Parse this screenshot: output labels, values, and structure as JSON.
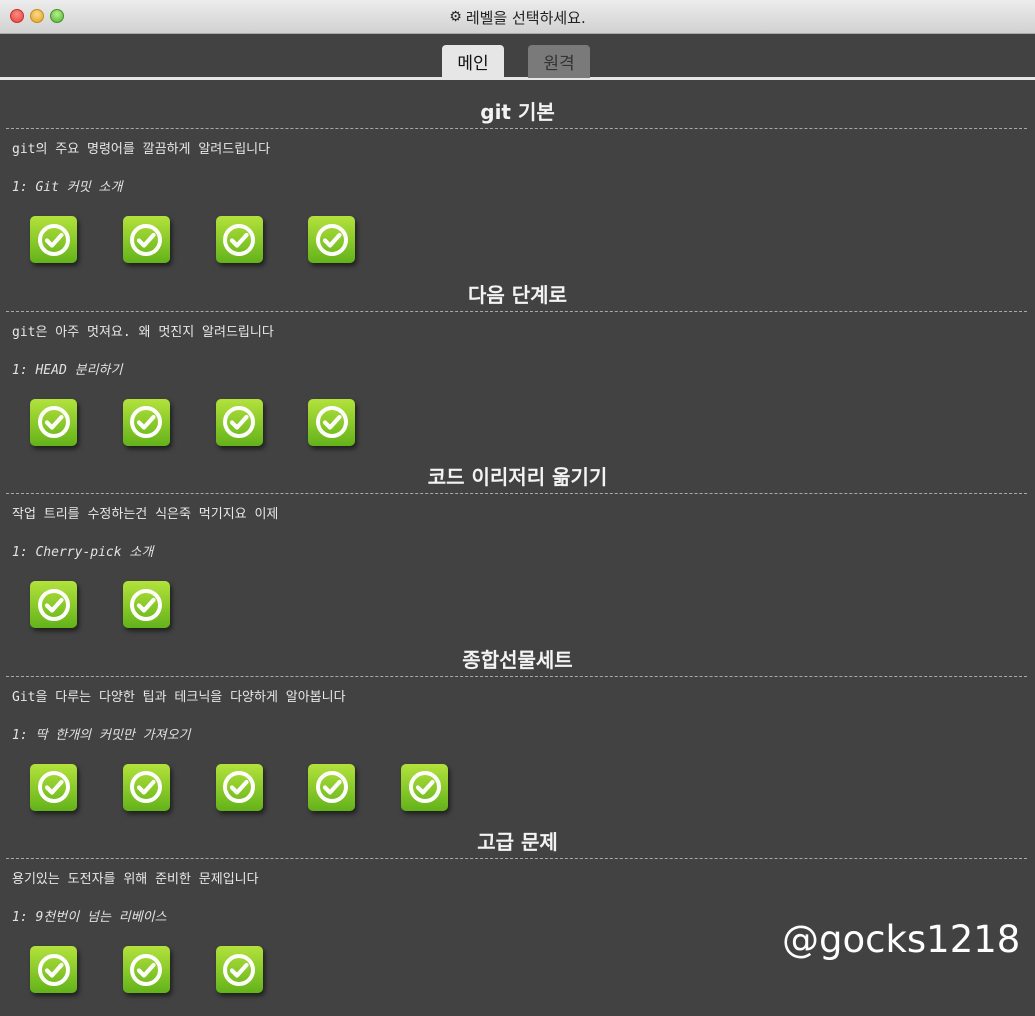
{
  "window": {
    "title": "레벨을 선택하세요.",
    "title_icon": "gear-icon"
  },
  "tabs": [
    {
      "label": "메인",
      "active": true
    },
    {
      "label": "원격",
      "active": false
    }
  ],
  "sequences": [
    {
      "title": "git 기본",
      "about": "git의 주요 명령어를 깔끔하게 알려드립니다",
      "current_level": "1: Git 커밋 소개",
      "levels_completed": 4
    },
    {
      "title": "다음 단계로",
      "about": "git은 아주 멋져요. 왜 멋진지 알려드립니다",
      "current_level": "1: HEAD 분리하기",
      "levels_completed": 4
    },
    {
      "title": "코드 이리저리 옮기기",
      "about": "작업 트리를 수정하는건 식은죽 먹기지요 이제",
      "current_level": "1: Cherry-pick 소개",
      "levels_completed": 2
    },
    {
      "title": "종합선물세트",
      "about": "Git을 다루는 다양한 팁과 테크닉을 다양하게 알아봅니다",
      "current_level": "1: 딱 한개의 커밋만 가져오기",
      "levels_completed": 5
    },
    {
      "title": "고급 문제",
      "about": "용기있는 도전자를 위해 준비한 문제입니다",
      "current_level": "1: 9천번이 넘는 리베이스",
      "levels_completed": 3
    }
  ],
  "level_icon": "checkmark-icon",
  "watermark": "@gocks1218",
  "colors": {
    "background": "#424242",
    "level_complete_top": "#b3e23c",
    "level_complete_bottom": "#63b31a",
    "active_tab": "#e6e6e6",
    "inactive_tab": "#7a7a7a"
  }
}
